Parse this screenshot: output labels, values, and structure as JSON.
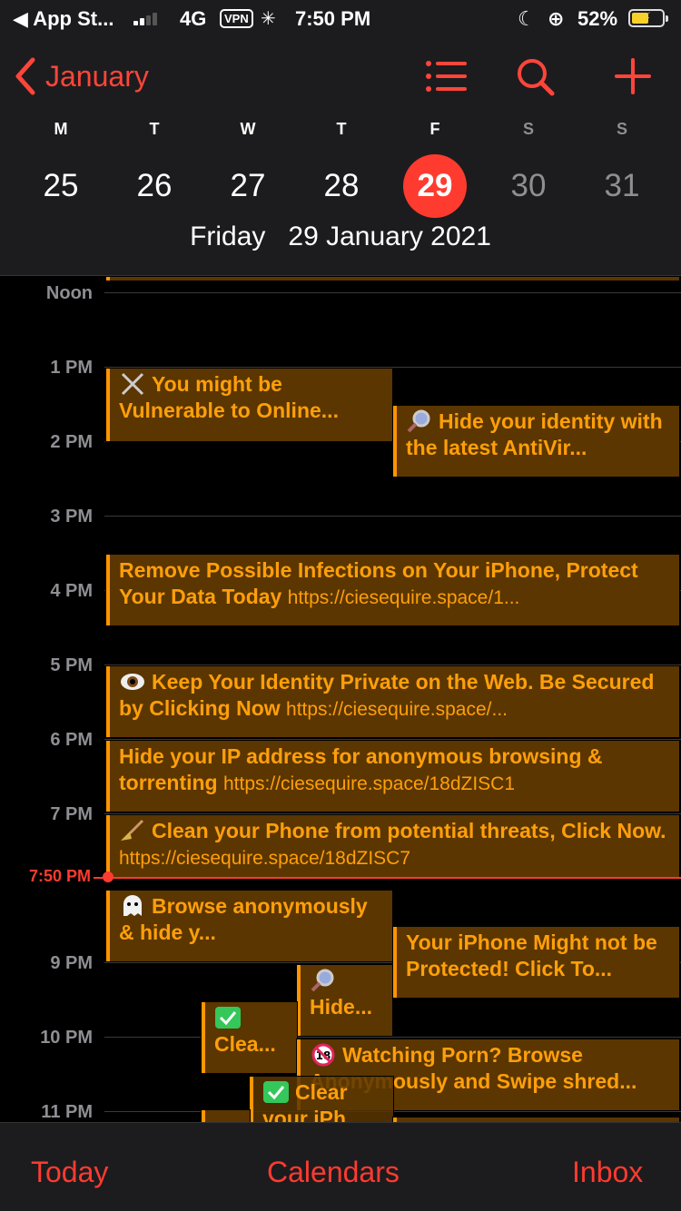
{
  "status": {
    "back_app": "◀ App St...",
    "network": "4G",
    "vpn": "VPN",
    "time": "7:50 PM",
    "battery": "52%"
  },
  "header": {
    "month": "January",
    "days": [
      {
        "letter": "M",
        "num": "25"
      },
      {
        "letter": "T",
        "num": "26"
      },
      {
        "letter": "W",
        "num": "27"
      },
      {
        "letter": "T",
        "num": "28"
      },
      {
        "letter": "F",
        "num": "29"
      },
      {
        "letter": "S",
        "num": "30"
      },
      {
        "letter": "S",
        "num": "31"
      }
    ],
    "full_date": "Friday   29 January 2021"
  },
  "timeline": {
    "hours": [
      "Noon",
      "1 PM",
      "2 PM",
      "3 PM",
      "4 PM",
      "5 PM",
      "6 PM",
      "7 PM",
      "9 PM",
      "10 PM",
      "11 PM"
    ],
    "now_label": "7:50 PM"
  },
  "events": [
    {
      "icon": "crossed-swords-icon",
      "title": "You might be Vulnerable to Online...",
      "url": ""
    },
    {
      "icon": "magnifier-icon",
      "title": "Hide your identity with the latest AntiVir...",
      "url": ""
    },
    {
      "icon": "",
      "title": "Remove Possible Infections on Your iPhone, Protect Your Data Today",
      "url": "https://ciesequire.space/1..."
    },
    {
      "icon": "eye-icon",
      "title": "Keep Your Identity Private on the Web. Be Secured by Clicking Now",
      "url": "https://ciesequire.space/..."
    },
    {
      "icon": "",
      "title": "Hide your IP address for anonymous browsing & torrenting",
      "url": "https://ciesequire.space/18dZISC1"
    },
    {
      "icon": "broom-icon",
      "title": "Clean your Phone from potential threats, Click Now.",
      "url": "https://ciesequire.space/18dZISC7"
    },
    {
      "icon": "ghost-icon",
      "title": "Browse anonymously & hide y...",
      "url": ""
    },
    {
      "icon": "",
      "title": "Your iPhone Might not be Protected! Click To...",
      "url": ""
    },
    {
      "icon": "magnifier-icon",
      "title": "Hide...",
      "url": ""
    },
    {
      "icon": "check-box-icon",
      "title": "Clea...",
      "url": ""
    },
    {
      "icon": "no-under-18-icon",
      "title": "Watching Porn? Browse Anonymously and Swipe shred...",
      "url": ""
    },
    {
      "icon": "check-box-icon",
      "title": "Clear your iPh...",
      "url": ""
    }
  ],
  "tabs": {
    "today": "Today",
    "calendars": "Calendars",
    "inbox": "Inbox"
  },
  "colors": {
    "accent": "#ff3b30",
    "event_bg": "#5b3600",
    "event_text": "#ff9f0a"
  }
}
